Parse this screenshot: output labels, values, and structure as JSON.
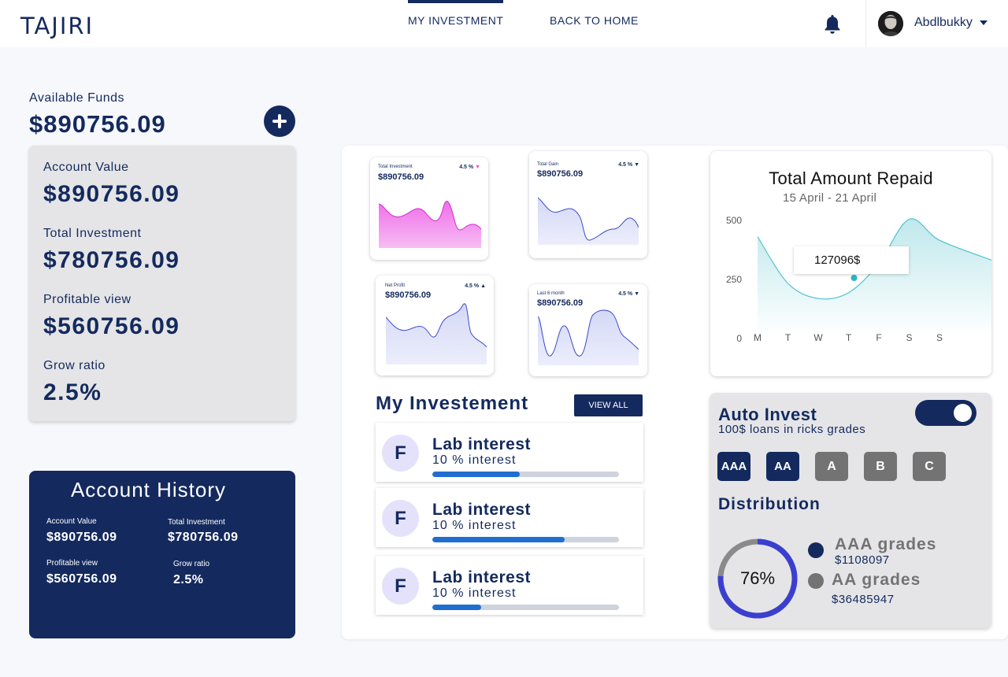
{
  "header": {
    "brand": "TAJIRI",
    "nav": [
      {
        "label": "MY INVESTMENT",
        "active": true
      },
      {
        "label": "BACK TO HOME",
        "active": false
      }
    ],
    "bell_icon": "bell-icon",
    "user": {
      "name": "Abdlbukky",
      "avatar_icon": "user-avatar",
      "caret_icon": "caret-down-icon"
    }
  },
  "funds": {
    "label": "Available Funds",
    "value": "$890756.09",
    "add_icon": "plus-icon"
  },
  "stats": [
    {
      "label": "Account Value",
      "value": "$890756.09"
    },
    {
      "label": "Total Investment",
      "value": "$780756.09"
    },
    {
      "label": "Profitable view",
      "value": "$560756.09"
    },
    {
      "label": "Grow ratio",
      "value": "2.5%"
    }
  ],
  "history": {
    "title": "Account History",
    "items": [
      {
        "label": "Account Value",
        "value": "$890756.09"
      },
      {
        "label": "Total Investment",
        "value": "$780756.09"
      },
      {
        "label": "Profitable view",
        "value": "$560756.09"
      },
      {
        "label": "Grow ratio",
        "value": "2.5%"
      }
    ]
  },
  "mini_cards": [
    {
      "title": "Total Investment",
      "value": "$890756.09",
      "pct": "4.5 %",
      "trend": "down",
      "color": "#e84fd0"
    },
    {
      "title": "Total Gain",
      "value": "$890756.09",
      "pct": "4.5 %",
      "trend": "down",
      "color": "#3a4bc8"
    },
    {
      "title": "Net Profit",
      "value": "$890756.09",
      "pct": "4.5 %",
      "trend": "up",
      "color": "#3a4bc8"
    },
    {
      "title": "Last 6 month",
      "value": "$890756.09",
      "pct": "4.5 %",
      "trend": "down",
      "color": "#3a4bc8"
    }
  ],
  "investments": {
    "title": "My Investement",
    "view_all": "VIEW ALL",
    "items": [
      {
        "badge": "F",
        "name": "Lab interest",
        "rate": "10 % interest",
        "progress": 0.47
      },
      {
        "badge": "F",
        "name": "Lab interest",
        "rate": "10 % interest",
        "progress": 0.71
      },
      {
        "badge": "F",
        "name": "Lab interest",
        "rate": "10 % interest",
        "progress": 0.26
      }
    ]
  },
  "chart_data": {
    "type": "area",
    "title": "Total Amount Repaid",
    "subtitle": "15 April - 21 April",
    "categories": [
      "M",
      "T",
      "W",
      "T",
      "F",
      "S",
      "S"
    ],
    "values": [
      430,
      230,
      165,
      190,
      315,
      505,
      415
    ],
    "y_ticks": [
      "0",
      "250",
      "500"
    ],
    "ylim": [
      0,
      500
    ],
    "tooltip": {
      "category_index": 3,
      "label": "127096$"
    },
    "grid": false,
    "color": "#4fc3d0"
  },
  "auto_invest": {
    "title": "Auto Invest",
    "subtitle": "100$ loans in ricks grades",
    "enabled": true,
    "grades": [
      {
        "label": "AAA",
        "selected": true
      },
      {
        "label": "AA",
        "selected": true
      },
      {
        "label": "A",
        "selected": false
      },
      {
        "label": "B",
        "selected": false
      },
      {
        "label": "C",
        "selected": false
      }
    ],
    "distribution": {
      "title": "Distribution",
      "percent_label": "76%",
      "percent": 0.76,
      "legend": [
        {
          "name": "AAA grades",
          "value": "$1108097",
          "color": "#142a5e"
        },
        {
          "name": "AA grades",
          "value": "$36485947",
          "color": "#737373"
        }
      ]
    }
  }
}
